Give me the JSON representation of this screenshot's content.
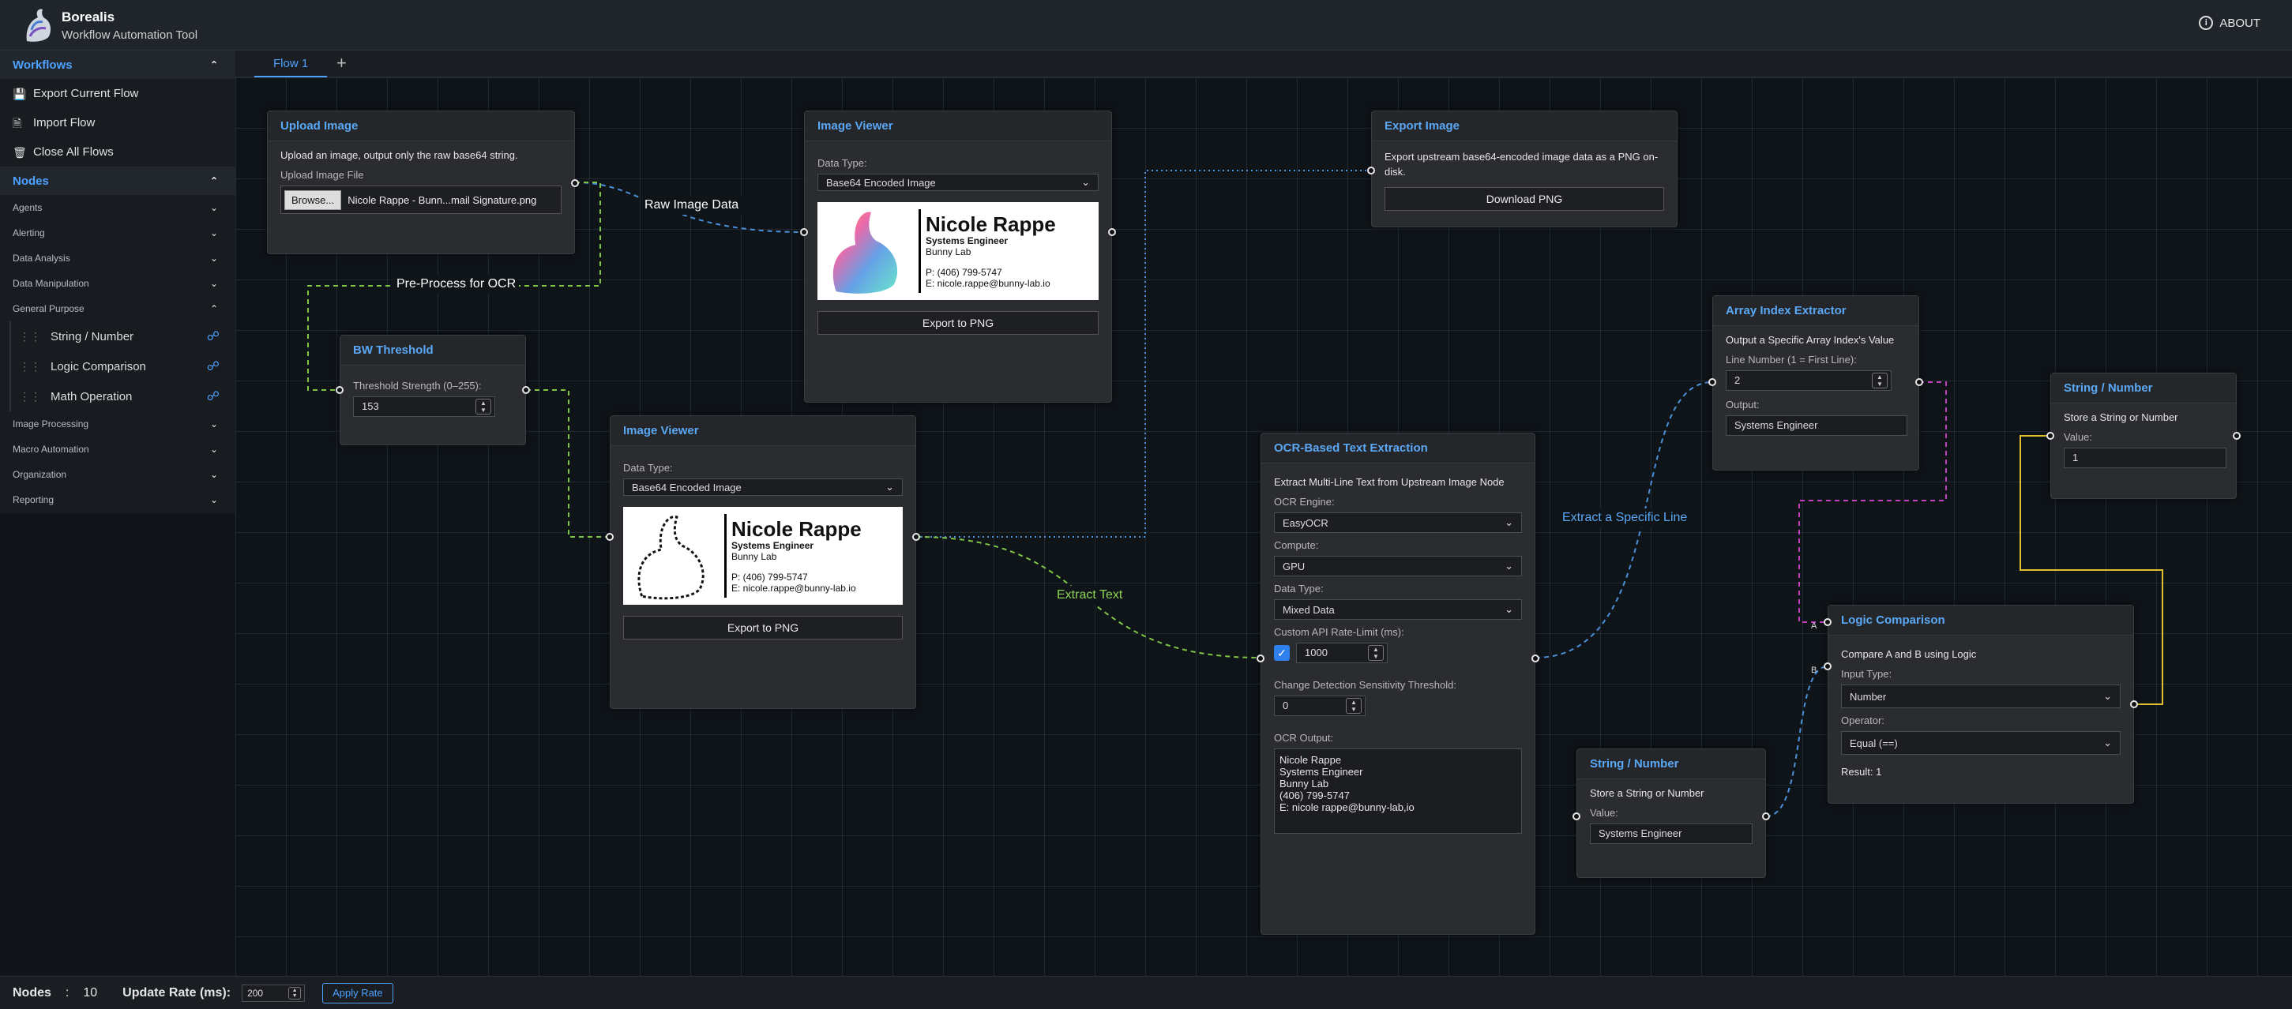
{
  "app": {
    "name": "Borealis",
    "subtitle": "Workflow Automation Tool",
    "about": "ABOUT"
  },
  "sidebar": {
    "workflows": {
      "label": "Workflows",
      "items": [
        {
          "label": "Export Current Flow",
          "icon": "save-icon"
        },
        {
          "label": "Import Flow",
          "icon": "file-import-icon"
        },
        {
          "label": "Close All Flows",
          "icon": "trash-icon"
        }
      ]
    },
    "nodes": {
      "label": "Nodes",
      "categories": [
        {
          "label": "Agents"
        },
        {
          "label": "Alerting"
        },
        {
          "label": "Data Analysis"
        },
        {
          "label": "Data Manipulation"
        },
        {
          "label": "General Purpose",
          "expanded": true,
          "items": [
            "String / Number",
            "Logic Comparison",
            "Math Operation"
          ]
        },
        {
          "label": "Image Processing"
        },
        {
          "label": "Macro Automation"
        },
        {
          "label": "Organization"
        },
        {
          "label": "Reporting"
        }
      ]
    }
  },
  "tabs": [
    {
      "label": "Flow 1",
      "active": true
    }
  ],
  "add_tab": "+",
  "statusbar": {
    "nodes_label": "Nodes",
    "separator": ":",
    "nodes_count": "10",
    "rate_label": "Update Rate (ms):",
    "rate_value": "200",
    "apply_label": "Apply Rate"
  },
  "edges": {
    "raw_image": "Raw Image Data",
    "preprocess": "Pre-Process for OCR",
    "extract_text": "Extract Text",
    "extract_line": "Extract a Specific Line",
    "port_a": "A",
    "port_b": "B"
  },
  "nodes": {
    "upload": {
      "title": "Upload Image",
      "desc": "Upload an image, output only the raw base64 string.",
      "file_label": "Upload Image File",
      "browse": "Browse...",
      "filename": "Nicole Rappe - Bunn...mail Signature.png"
    },
    "viewer1": {
      "title": "Image Viewer",
      "type_label": "Data Type:",
      "type_value": "Base64 Encoded Image",
      "export": "Export to PNG"
    },
    "viewer2": {
      "title": "Image Viewer",
      "type_label": "Data Type:",
      "type_value": "Base64 Encoded Image",
      "export": "Export to PNG"
    },
    "card": {
      "name": "Nicole Rappe",
      "role": "Systems Engineer",
      "org": "Bunny Lab",
      "phone": "P: (406) 799-5747",
      "email": "E: nicole.rappe@bunny-lab.io"
    },
    "export": {
      "title": "Export Image",
      "desc": "Export upstream base64-encoded image data as a PNG on-disk.",
      "button": "Download PNG"
    },
    "bw": {
      "title": "BW Threshold",
      "label": "Threshold Strength (0–255):",
      "value": "153"
    },
    "ocr": {
      "title": "OCR-Based Text Extraction",
      "desc": "Extract Multi-Line Text from Upstream Image Node",
      "engine_label": "OCR Engine:",
      "engine": "EasyOCR",
      "compute_label": "Compute:",
      "compute": "GPU",
      "type_label": "Data Type:",
      "type": "Mixed Data",
      "rate_label": "Custom API Rate-Limit (ms):",
      "rate": "1000",
      "thresh_label": "Change Detection Sensitivity Threshold:",
      "thresh": "0",
      "output_label": "OCR Output:",
      "output": "Nicole Rappe\nSystems Engineer\nBunny Lab\n(406) 799-5747\nE: nicole rappe@bunny-lab,io"
    },
    "array": {
      "title": "Array Index Extractor",
      "desc": "Output a Specific Array Index's Value",
      "line_label": "Line Number (1 = First Line):",
      "line": "2",
      "output_label": "Output:",
      "output": "Systems Engineer"
    },
    "str1": {
      "title": "String / Number",
      "desc": "Store a String or Number",
      "value_label": "Value:",
      "value": "1"
    },
    "str2": {
      "title": "String / Number",
      "desc": "Store a String or Number",
      "value_label": "Value:",
      "value": "Systems Engineer"
    },
    "logic": {
      "title": "Logic Comparison",
      "desc": "Compare A and B using Logic",
      "input_label": "Input Type:",
      "input": "Number",
      "op_label": "Operator:",
      "op": "Equal (==)",
      "result": "Result: 1"
    }
  },
  "colors": {
    "accent": "#4ea2ff",
    "wire_blue": "#4a90d9",
    "wire_green": "#7fc545",
    "wire_magenta": "#c040c0",
    "wire_yellow": "#e0c030"
  }
}
